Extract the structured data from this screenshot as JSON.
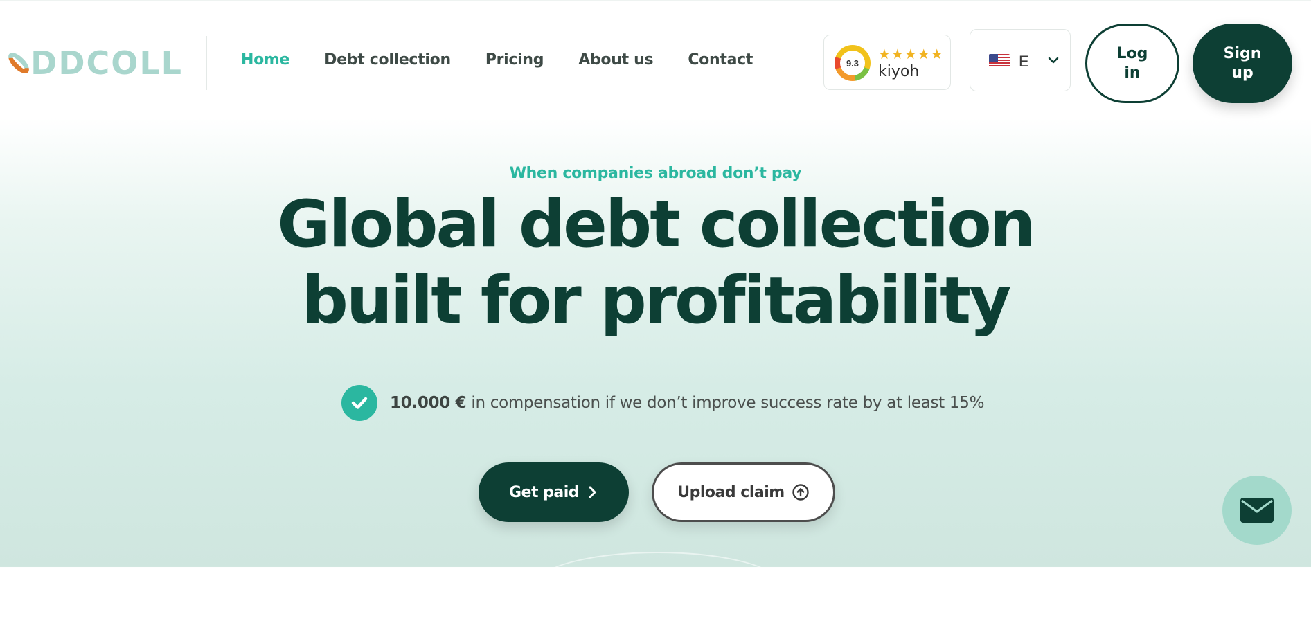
{
  "header": {
    "logo_text": "ODDCOLL",
    "nav": [
      {
        "label": "Home",
        "active": true
      },
      {
        "label": "Debt collection",
        "active": false
      },
      {
        "label": "Pricing",
        "active": false
      },
      {
        "label": "About us",
        "active": false
      },
      {
        "label": "Contact",
        "active": false
      }
    ],
    "review": {
      "score": "9.3",
      "stars": "★★★★★",
      "brand": "kiyoh"
    },
    "language": {
      "code": "E",
      "flag": "us-flag-icon"
    },
    "login_label": "Log in",
    "signup_label": "Sign up"
  },
  "hero": {
    "eyebrow": "When companies abroad don’t pay",
    "headline_line1": "Global debt collection",
    "headline_line2": "built for profitability",
    "guarantee_amount": "10.000 €",
    "guarantee_text": " in compensation if we don’t improve success rate by at least 15%",
    "cta_primary": "Get paid",
    "cta_secondary": "Upload claim"
  },
  "colors": {
    "brand_dark": "#0d3f34",
    "accent_teal": "#2bb7a0",
    "logo_mint": "#a9d6cd",
    "logo_orange": "#e07a2a",
    "fab_bg": "#a3d9cb"
  },
  "icons": [
    "check-icon",
    "chevron-right-icon",
    "upload-icon",
    "chevron-down-icon",
    "mail-icon",
    "us-flag-icon",
    "star-icon"
  ]
}
